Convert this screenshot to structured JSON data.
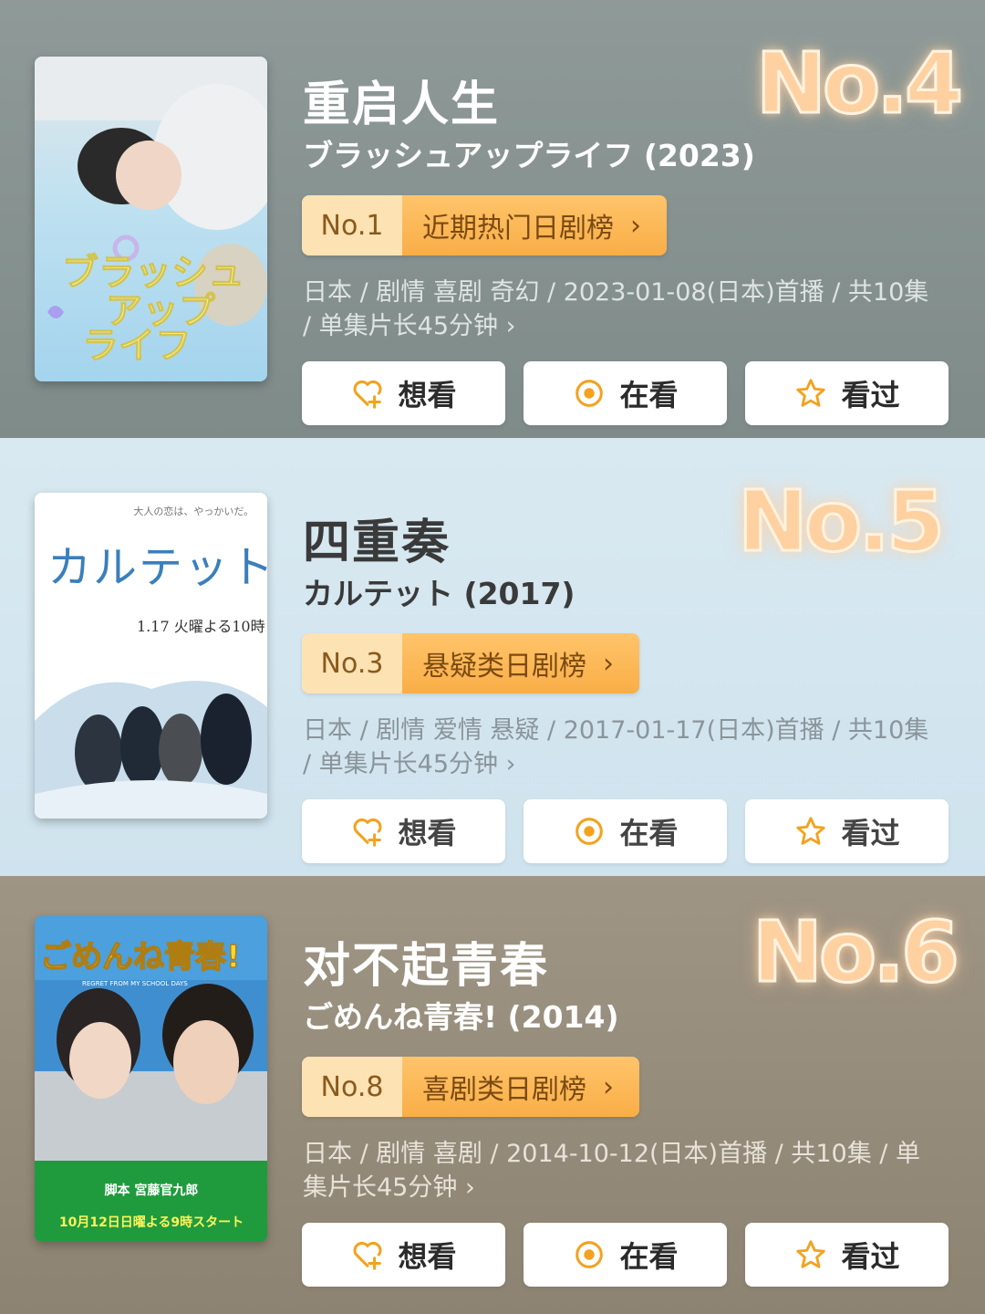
{
  "colors": {
    "accent_orange": "#f9ae47",
    "icon_orange": "#f3a21f",
    "rank_glow": "#ffd0a0"
  },
  "cards": [
    {
      "rank": "No.4",
      "title": "重启人生",
      "subtitle": "ブラッシュアップライフ (2023)",
      "chart_no": "No.1",
      "chart_name": "近期热门日剧榜",
      "meta": "日本 / 剧情 喜剧 奇幻 / 2023-01-08(日本)首播 / 共10集 / 单集片长45分钟 ›",
      "poster_text": "ブラッシュアップライフ",
      "actions": [
        "想看",
        "在看",
        "看过"
      ]
    },
    {
      "rank": "No.5",
      "title": "四重奏",
      "subtitle": "カルテット (2017)",
      "chart_no": "No.3",
      "chart_name": "悬疑类日剧榜",
      "meta": "日本 / 剧情 爱情 悬疑 / 2017-01-17(日本)首播 / 共10集 / 单集片长45分钟 ›",
      "poster_text": "カルテット",
      "poster_caption": "大人の恋は、やっかいだ。",
      "poster_date": "1.17 火曜よる10時",
      "actions": [
        "想看",
        "在看",
        "看过"
      ]
    },
    {
      "rank": "No.6",
      "title": "对不起青春",
      "subtitle": "ごめんね青春! (2014)",
      "chart_no": "No.8",
      "chart_name": "喜剧类日剧榜",
      "meta": "日本 / 剧情 喜剧 / 2014-10-12(日本)首播 / 共10集 / 单集片长45分钟 ›",
      "poster_text": "ごめんね青春!",
      "poster_sub": "REGRET FROM MY SCHOOL DAYS",
      "poster_writer": "脚本 宮藤官九郎",
      "poster_date": "10月12日日曜よる9時スタート",
      "actions": [
        "想看",
        "在看",
        "看过"
      ]
    }
  ],
  "icons": {
    "want": "heart-plus-icon",
    "watching": "target-circle-icon",
    "watched": "star-icon",
    "chevron": "chevron-right-icon"
  }
}
